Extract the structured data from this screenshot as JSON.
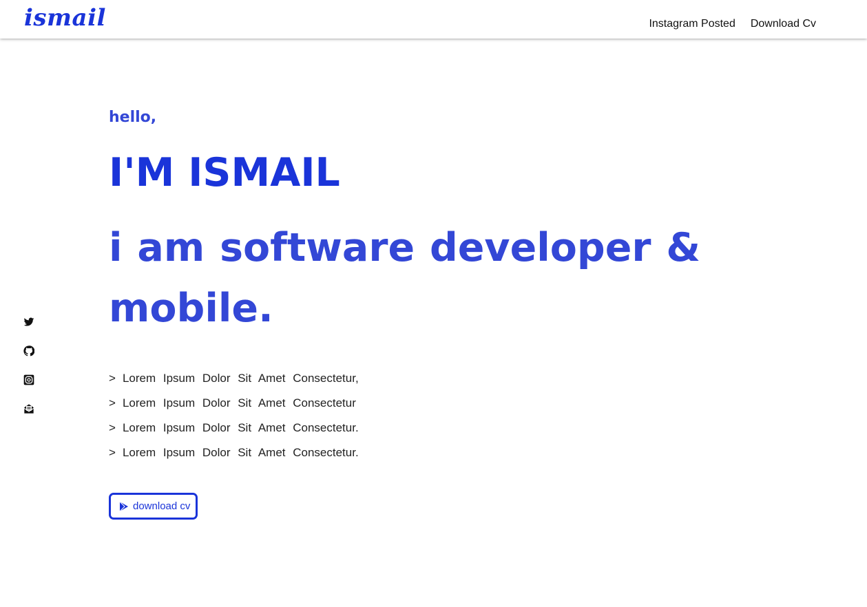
{
  "brand": {
    "logo": "ismail",
    "accent_color": "#1a34d9",
    "secondary_color": "#3347d6"
  },
  "nav": {
    "links": [
      {
        "label": "Instagram Posted"
      },
      {
        "label": "Download Cv"
      }
    ]
  },
  "social": [
    {
      "icon": "twitter-icon"
    },
    {
      "icon": "github-icon"
    },
    {
      "icon": "instagram-icon"
    },
    {
      "icon": "mail-icon"
    }
  ],
  "hero": {
    "greeting": "hello,",
    "name": "I'M ISMAIL",
    "role": "i am software developer & mobile.",
    "bullet_prefix": ">",
    "bullets": [
      "Lorem Ipsum Dolor Sit Amet Consectetur,",
      "Lorem Ipsum Dolor Sit Amet Consectetur",
      "Lorem Ipsum Dolor Sit Amet Consectetur.",
      "Lorem Ipsum Dolor Sit Amet Consectetur."
    ],
    "button": {
      "label": "download cv",
      "icon": "play-icon"
    }
  }
}
